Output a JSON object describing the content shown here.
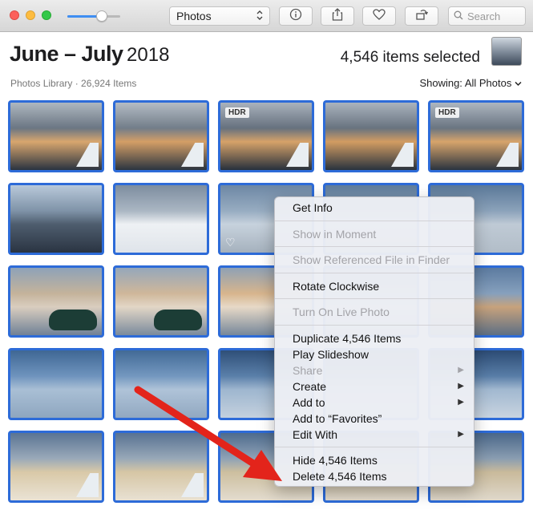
{
  "toolbar": {
    "zoom_percent": 65,
    "view_popup_value": "Photos",
    "search_placeholder": "Search",
    "buttons": [
      "info-icon",
      "share-icon",
      "heart-icon",
      "rotate-icon"
    ]
  },
  "header": {
    "title_bold": "June – July",
    "title_year": "2018",
    "selected_text": "4,546 items selected",
    "subtitle": "Photos Library · 26,924 Items",
    "showing_label": "Showing:",
    "showing_value": "All Photos"
  },
  "photos": [
    {
      "sky": [
        "#aeb7c0",
        "#6b7683",
        "#d8a66e",
        "#2a3340"
      ],
      "hdr": false,
      "overlay": "wing"
    },
    {
      "sky": [
        "#b4bcc5",
        "#727d89",
        "#d49e66",
        "#2b3440"
      ],
      "hdr": false,
      "overlay": "wing"
    },
    {
      "sky": [
        "#a9b2bd",
        "#66717e",
        "#d6a269",
        "#27303c"
      ],
      "hdr": true,
      "overlay": "wing"
    },
    {
      "sky": [
        "#aab3be",
        "#68737f",
        "#d29c62",
        "#29323e"
      ],
      "hdr": false,
      "overlay": "wing"
    },
    {
      "sky": [
        "#adb6c0",
        "#6a7581",
        "#d7a46b",
        "#2a333f"
      ],
      "hdr": true,
      "overlay": "wing"
    },
    {
      "sky": [
        "#b9c9da",
        "#7f93a8",
        "#4e5d6e",
        "#2a3442"
      ],
      "hdr": false,
      "overlay": "none"
    },
    {
      "sky": [
        "#7d8d9f",
        "#aab6c3",
        "#eef1f4",
        "#dfe4ea"
      ],
      "hdr": false,
      "overlay": "none"
    },
    {
      "sky": [
        "#6d87a4",
        "#97acc1",
        "#c7d2dd",
        "#a5b1bd"
      ],
      "hdr": false,
      "overlay": "heart"
    },
    {
      "sky": [
        "#5f7c9b",
        "#8fa6bd",
        "#c1ccd6",
        "#9eabb8"
      ],
      "hdr": false,
      "overlay": "none"
    },
    {
      "sky": [
        "#5a7898",
        "#8ba2ba",
        "#bfcad5",
        "#b2bdc8"
      ],
      "hdr": false,
      "overlay": "none"
    },
    {
      "sky": [
        "#8ea2b8",
        "#c4b39b",
        "#d9cdbf",
        "#708196"
      ],
      "hdr": false,
      "overlay": "engine"
    },
    {
      "sky": [
        "#95a7bb",
        "#cfb79a",
        "#e2d6c6",
        "#7a8a9c"
      ],
      "hdr": false,
      "overlay": "engine"
    },
    {
      "sky": [
        "#8fa1b5",
        "#d7b58d",
        "#e7d9c7",
        "#76879a"
      ],
      "hdr": false,
      "overlay": "none"
    },
    {
      "sky": [
        "#6f8bab",
        "#9fb3c8",
        "#cfd8e1",
        "#8c9eb1"
      ],
      "hdr": false,
      "overlay": "none"
    },
    {
      "sky": [
        "#5c7ba0",
        "#86a0bd",
        "#c7a27c",
        "#5d6f84"
      ],
      "hdr": false,
      "overlay": "none"
    },
    {
      "sky": [
        "#3f6794",
        "#6e93bd",
        "#a9bfd5",
        "#8ea6bf"
      ],
      "hdr": false,
      "overlay": "none"
    },
    {
      "sky": [
        "#426a96",
        "#7397bf",
        "#afc3d8",
        "#91a8c1"
      ],
      "hdr": false,
      "overlay": "none"
    },
    {
      "sky": [
        "#2f4f78",
        "#5a7fa9",
        "#9eb6cf",
        "#c4d1de"
      ],
      "hdr": false,
      "overlay": "none"
    },
    {
      "sky": [
        "#34557e",
        "#6083ad",
        "#a6bcd3",
        "#c7d3df"
      ],
      "hdr": false,
      "overlay": "none"
    },
    {
      "sky": [
        "#2c4b74",
        "#587da7",
        "#a1b8d0",
        "#c9d4e0"
      ],
      "hdr": false,
      "overlay": "none"
    },
    {
      "sky": [
        "#5a7493",
        "#9aa9b9",
        "#d9c9a8",
        "#eae3d5"
      ],
      "hdr": false,
      "overlay": "wing"
    },
    {
      "sky": [
        "#587292",
        "#98a8b8",
        "#d6c6a5",
        "#e8e1d3"
      ],
      "hdr": false,
      "overlay": "wing"
    },
    {
      "sky": [
        "#4e6b8d",
        "#8fa2b6",
        "#cdbf9f",
        "#e3dccf"
      ],
      "hdr": false,
      "overlay": "none"
    },
    {
      "sky": [
        "#4b688a",
        "#8c9fb3",
        "#cbbc9d",
        "#e1dacd"
      ],
      "hdr": false,
      "overlay": "none"
    },
    {
      "sky": [
        "#4a6789",
        "#8a9db1",
        "#c9ba9b",
        "#dfd8cb"
      ],
      "hdr": false,
      "overlay": "none"
    }
  ],
  "menu": {
    "items": [
      {
        "label": "Get Info",
        "enabled": true,
        "submenu": false
      },
      {
        "label": "Show in Moment",
        "enabled": false,
        "submenu": false
      },
      {
        "label": "Show Referenced File in Finder",
        "enabled": false,
        "submenu": false
      },
      {
        "label": "Rotate Clockwise",
        "enabled": true,
        "submenu": false
      },
      {
        "label": "Turn On Live Photo",
        "enabled": false,
        "submenu": false
      },
      {
        "label": "Duplicate 4,546 Items",
        "enabled": true,
        "submenu": false
      },
      {
        "label": "Play Slideshow",
        "enabled": true,
        "submenu": false
      },
      {
        "label": "Share",
        "enabled": false,
        "submenu": true
      },
      {
        "label": "Create",
        "enabled": true,
        "submenu": true
      },
      {
        "label": "Add to",
        "enabled": true,
        "submenu": true
      },
      {
        "label": "Add to “Favorites”",
        "enabled": true,
        "submenu": false
      },
      {
        "label": "Edit With",
        "enabled": true,
        "submenu": true
      },
      {
        "label": "Hide 4,546 Items",
        "enabled": true,
        "submenu": false
      },
      {
        "label": "Delete 4,546 Items",
        "enabled": true,
        "submenu": false
      }
    ]
  },
  "colors": {
    "selection_border": "#2d6bd8",
    "annotation_arrow": "#e3241b",
    "accent": "#3f8ef2"
  }
}
